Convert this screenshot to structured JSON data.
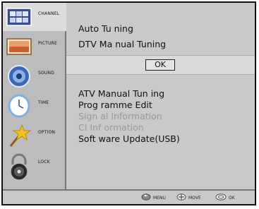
{
  "sidebar": {
    "items": [
      {
        "label": "CHANNEL",
        "icon": "tv-channel-icon",
        "active": true
      },
      {
        "label": "PICTURE",
        "icon": "picture-icon",
        "active": false
      },
      {
        "label": "SOUND",
        "icon": "sound-icon",
        "active": false
      },
      {
        "label": "TIME",
        "icon": "clock-icon",
        "active": false
      },
      {
        "label": "OPTION",
        "icon": "option-star-icon",
        "active": false
      },
      {
        "label": "LOCK",
        "icon": "lock-icon",
        "active": false
      }
    ]
  },
  "menu": {
    "auto_tuning": "Auto Tu ning",
    "dtv_manual_tuning": "DTV Ma nual Tuning",
    "ok_label": "OK",
    "atv_manual_tuning": "ATV Manual Tun ing",
    "programme_edit": "Prog ramme Edit",
    "signal_information": "Sign al Information",
    "ci_information": "CI Inf ormation",
    "software_update": "Soft ware Update(USB)"
  },
  "footer": {
    "menu_hint": "MENU",
    "move_hint": "MOVE",
    "ok_hint": "OK"
  },
  "colors": {
    "background": "#c9c9c9",
    "highlight": "#d9d9d9",
    "disabled_text": "#9a9a9a"
  }
}
